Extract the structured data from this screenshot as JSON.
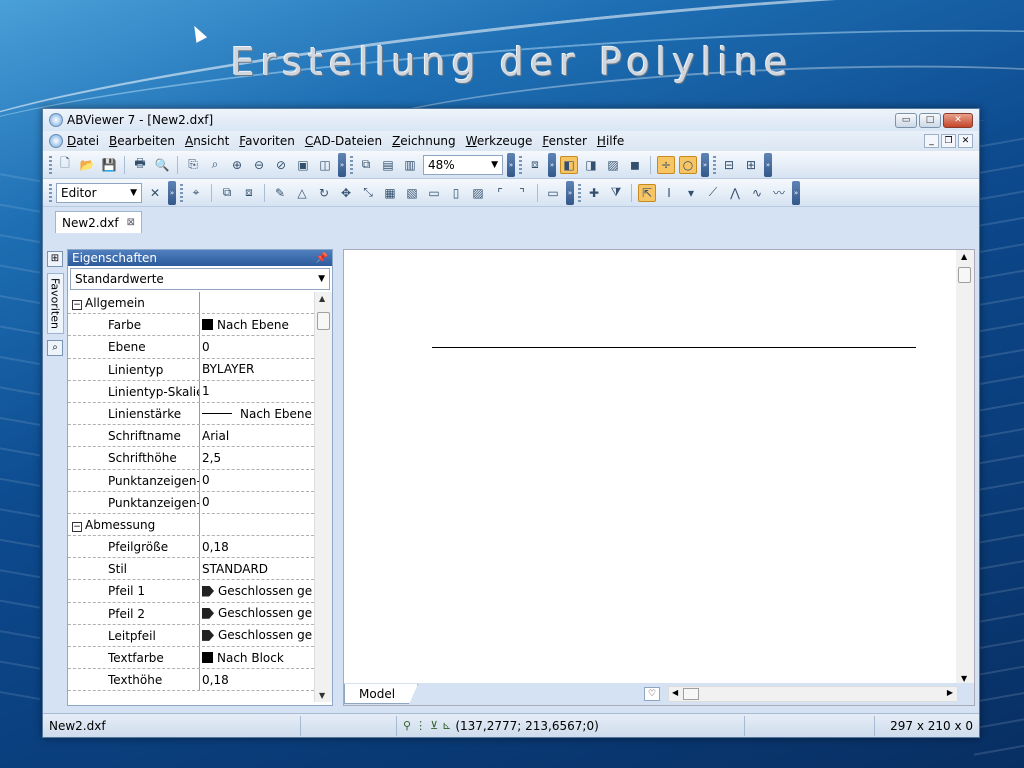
{
  "slide": {
    "title": "Erstellung der Polyline"
  },
  "window": {
    "title": "ABViewer 7 - [New2.dxf]",
    "buttons": {
      "minimize": "▭",
      "maximize": "□",
      "close": "✕"
    }
  },
  "menu": {
    "items": [
      "Datei",
      "Bearbeiten",
      "Ansicht",
      "Favoriten",
      "CAD-Dateien",
      "Zeichnung",
      "Werkzeuge",
      "Fenster",
      "Hilfe"
    ]
  },
  "toolbar": {
    "zoom_value": "48%",
    "mode_value": "Editor"
  },
  "tabs": {
    "document": "New2.dxf"
  },
  "favorites": {
    "label": "Favoriten"
  },
  "properties": {
    "header": "Eigenschaften",
    "preset": "Standardwerte",
    "rows": [
      {
        "key": "Allgemein",
        "value": "",
        "category": true
      },
      {
        "key": "Farbe",
        "value": "Nach Ebene",
        "marker": "swatch"
      },
      {
        "key": "Ebene",
        "value": "0"
      },
      {
        "key": "Linientyp",
        "value": "BYLAYER"
      },
      {
        "key": "Linientyp-Skalie",
        "value": "1"
      },
      {
        "key": "Linienstärke",
        "value": "Nach Ebene",
        "marker": "line"
      },
      {
        "key": "Schriftname",
        "value": "Arial"
      },
      {
        "key": "Schrifthöhe",
        "value": "2,5"
      },
      {
        "key": "Punktanzeigen-",
        "value": "0"
      },
      {
        "key": "Punktanzeigen-",
        "value": "0"
      },
      {
        "key": "Abmessung",
        "value": "",
        "category": true
      },
      {
        "key": "Pfeilgröße",
        "value": "0,18"
      },
      {
        "key": "Stil",
        "value": "STANDARD"
      },
      {
        "key": "Pfeil 1",
        "value": "Geschlossen ge",
        "marker": "arrow"
      },
      {
        "key": "Pfeil 2",
        "value": "Geschlossen ge",
        "marker": "arrow"
      },
      {
        "key": "Leitpfeil",
        "value": "Geschlossen ge",
        "marker": "arrow"
      },
      {
        "key": "Textfarbe",
        "value": "Nach Block",
        "marker": "swatch"
      },
      {
        "key": "Texthöhe",
        "value": "0,18"
      }
    ]
  },
  "canvas": {
    "layout_tab": "Model"
  },
  "status": {
    "file": "New2.dxf",
    "coordinates": "(137,2777; 213,6567;0)",
    "paper_size": "297 x 210 x 0"
  }
}
